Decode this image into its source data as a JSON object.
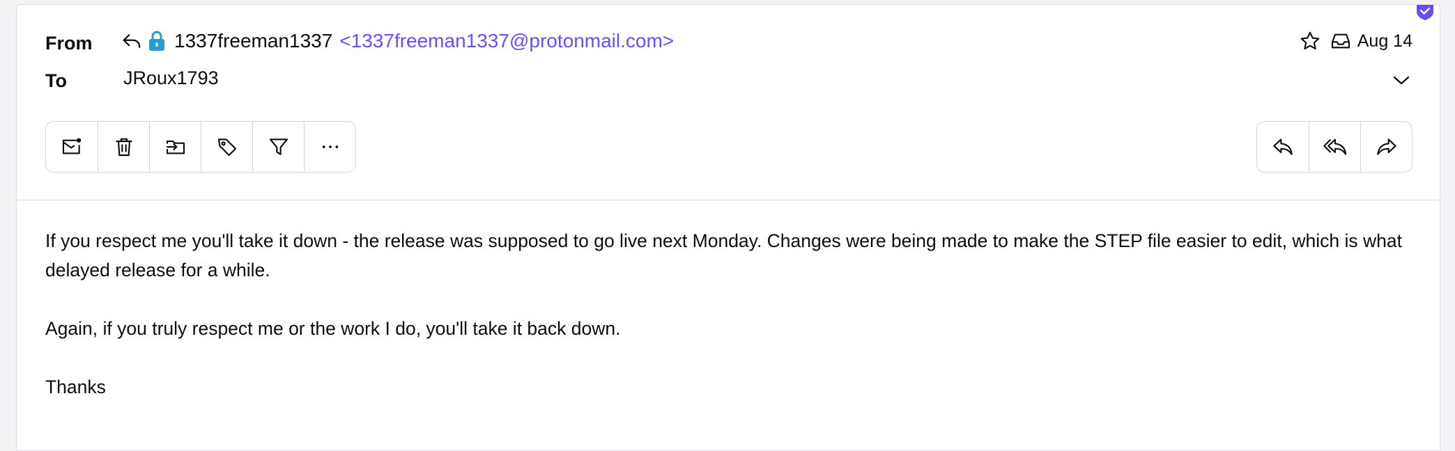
{
  "message": {
    "from_label": "From",
    "to_label": "To",
    "sender_name": "1337freeman1337",
    "sender_address": "<1337freeman1337@protonmail.com>",
    "recipient": "JRoux1793",
    "date": "Aug 14"
  },
  "icons": {
    "replied": "reply-icon",
    "encryption": "lock-icon",
    "star": "star-icon",
    "location": "inbox-icon",
    "expand": "chevron-down-icon",
    "verified": "shield-check-icon"
  },
  "toolbar": {
    "left": [
      "mark-unread-icon",
      "trash-icon",
      "move-to-icon",
      "label-icon",
      "filter-icon",
      "more-icon"
    ],
    "right": [
      "reply-icon",
      "reply-all-icon",
      "forward-icon"
    ]
  },
  "body": {
    "paragraph1": "If you respect me you'll take it down - the release was supposed to go live next Monday. Changes were being made to make the STEP file easier to edit, which is what delayed release for a while.",
    "paragraph2": "Again, if you truly respect me or the work I do, you'll take it back down.",
    "paragraph3": "Thanks"
  },
  "colors": {
    "accent": "#6d4aff",
    "lock": "#239ece",
    "text": "#0c0c14",
    "border": "#d6d3dd"
  }
}
